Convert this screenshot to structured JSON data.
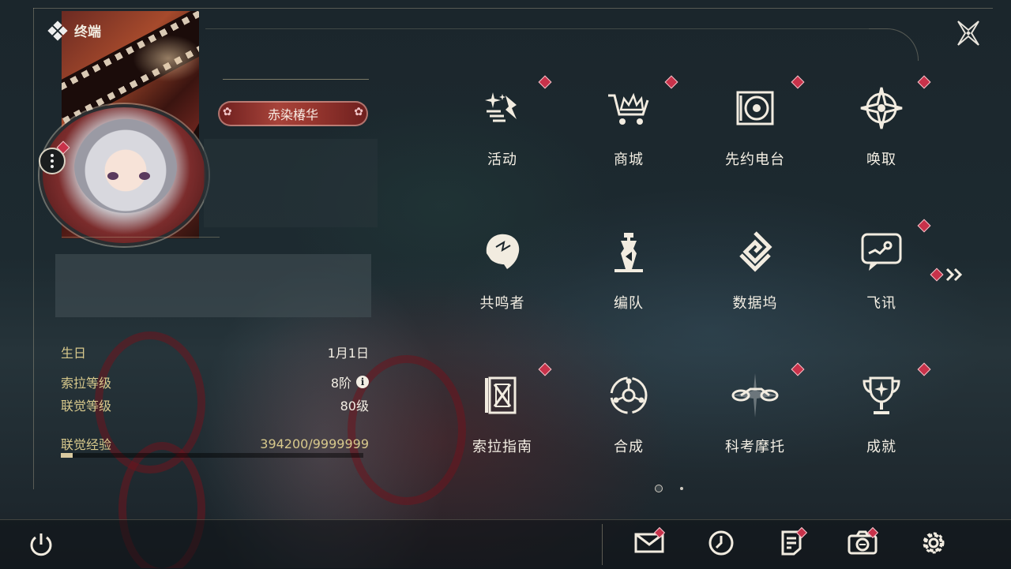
{
  "header": {
    "title": "终端",
    "close_icon": "close-x-icon"
  },
  "profile": {
    "name": "赤染椿华",
    "stats": [
      {
        "label": "生日",
        "value": "1月1日"
      },
      {
        "label": "索拉等级",
        "value": "8阶",
        "has_info": true
      },
      {
        "label": "联觉等级",
        "value": "80级"
      }
    ],
    "exp": {
      "label": "联觉经验",
      "value": "394200/9999999",
      "progress": 0.0394
    }
  },
  "menu": [
    {
      "label": "活动",
      "icon": "activity-sparkle-icon",
      "badge": true
    },
    {
      "label": "商城",
      "icon": "shop-cart-icon",
      "badge": true
    },
    {
      "label": "先约电台",
      "icon": "radio-record-icon",
      "badge": true
    },
    {
      "label": "唤取",
      "icon": "convene-star-icon",
      "badge": true
    },
    {
      "label": "共鸣者",
      "icon": "resonator-head-icon",
      "badge": false
    },
    {
      "label": "编队",
      "icon": "team-chess-icon",
      "badge": false
    },
    {
      "label": "数据坞",
      "icon": "data-bank-icon",
      "badge": false
    },
    {
      "label": "飞讯",
      "icon": "message-chat-icon",
      "badge": true
    },
    {
      "label": "索拉指南",
      "icon": "guide-book-icon",
      "badge": true
    },
    {
      "label": "合成",
      "icon": "synthesis-icon",
      "badge": false
    },
    {
      "label": "科考摩托",
      "icon": "motorbike-icon",
      "badge": true
    },
    {
      "label": "成就",
      "icon": "achievement-trophy-icon",
      "badge": true
    }
  ],
  "pagination": {
    "current": 1,
    "total": 2
  },
  "bottom_bar": [
    {
      "icon": "mail-icon",
      "badge": true
    },
    {
      "icon": "clock-icon",
      "badge": false
    },
    {
      "icon": "notice-icon",
      "badge": true
    },
    {
      "icon": "camera-icon",
      "badge": true
    },
    {
      "icon": "settings-gear-icon",
      "badge": false
    }
  ],
  "colors": {
    "badge": "#c8324a",
    "accent_gold": "#d8c98c",
    "name_plate": "#a7433a"
  }
}
